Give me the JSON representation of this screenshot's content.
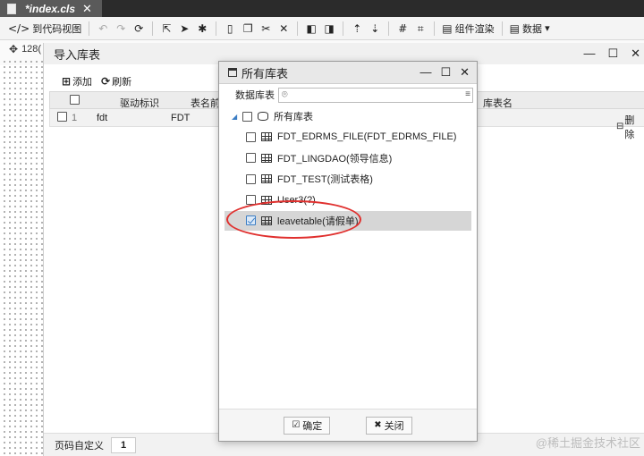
{
  "file_tab": {
    "title": "*index.cls",
    "close": "✕"
  },
  "toolbar": {
    "to_code_view": "到代码视图",
    "component_render": "组件渲染",
    "data": "数据",
    "data_caret": "▾"
  },
  "position_label": "128(",
  "import_dialog": {
    "title": "导入库表",
    "add": "添加",
    "refresh": "刷新",
    "columns": {
      "driver_id": "驱动标识",
      "table_prefix": "表名前",
      "db_table_name": "库表名"
    },
    "row": {
      "index": "1",
      "driver": "fdt",
      "prefix": "FDT",
      "delete": "删除"
    },
    "page_label": "页码自定义",
    "page_value": "1"
  },
  "modal": {
    "title": "所有库表",
    "search_label": "数据库表",
    "search_value": "",
    "root": "所有库表",
    "tables": [
      {
        "label": "FDT_EDRMS_FILE(FDT_EDRMS_FILE)",
        "checked": false
      },
      {
        "label": "FDT_LINGDAO(领导信息)",
        "checked": false
      },
      {
        "label": "FDT_TEST(测试表格)",
        "checked": false
      },
      {
        "label": "User3(?)",
        "checked": false
      },
      {
        "label": "leavetable(请假单)",
        "checked": true
      }
    ],
    "ok": "确定",
    "close": "关闭"
  },
  "watermark": "@稀土掘金技术社区",
  "colors": {
    "highlight_ellipse": "#e0302e",
    "accent": "#3b7dc4"
  }
}
